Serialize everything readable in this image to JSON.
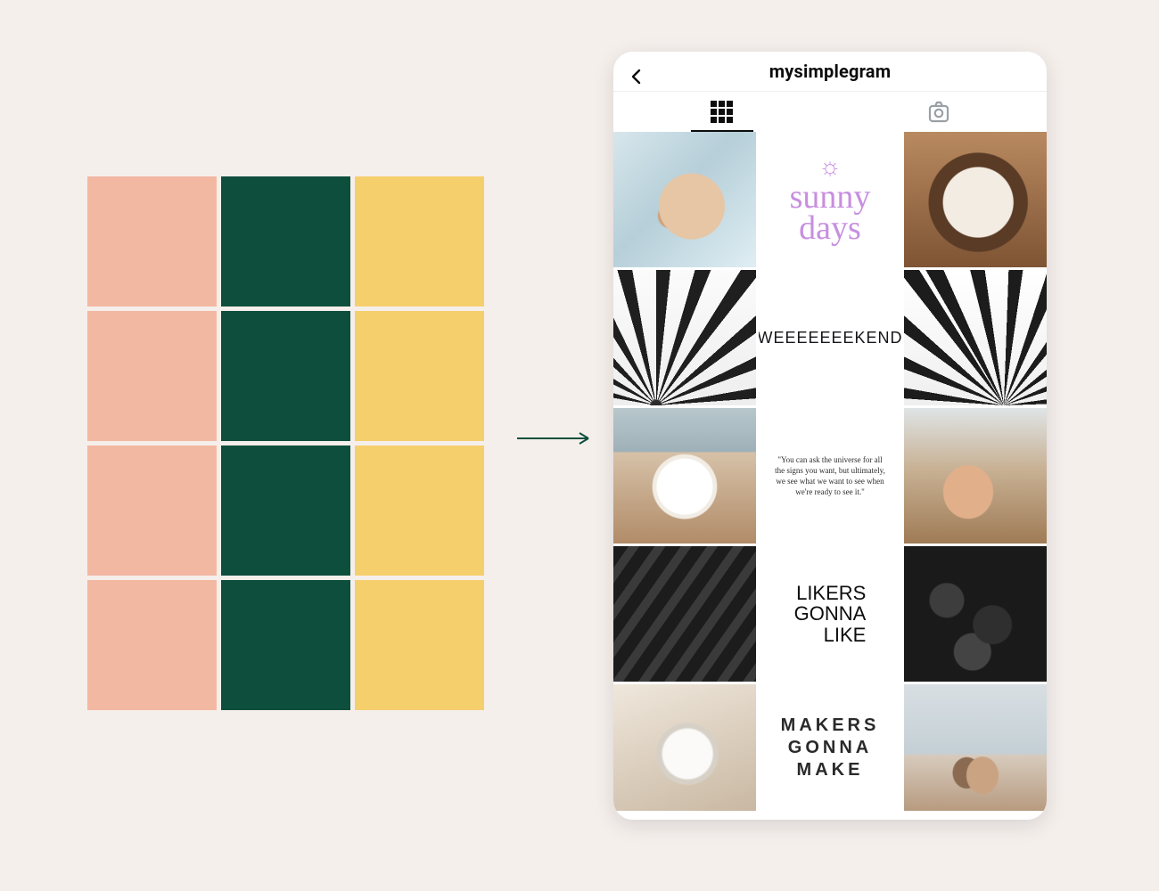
{
  "palette": {
    "columns": [
      "#f2b8a2",
      "#0d4f3c",
      "#f6cf6d"
    ],
    "rows": 4
  },
  "arrow_color": "#0d4f3c",
  "profile": {
    "username": "mysimplegram",
    "tabs": {
      "grid_active": true
    },
    "posts": {
      "sunny_line1": "sunny",
      "sunny_line2": "days",
      "weekend": "WEEEEEEEKEND",
      "quote": "\"You can ask the universe for all the signs you want, but ultimately, we see what we want to see when we're ready to see it.\"",
      "likers_line1": "LIKERS",
      "likers_line2": "GONNA",
      "likers_line3": "LIKE",
      "makers_line1": "MAKERS",
      "makers_line2": "GONNA MAKE"
    }
  }
}
